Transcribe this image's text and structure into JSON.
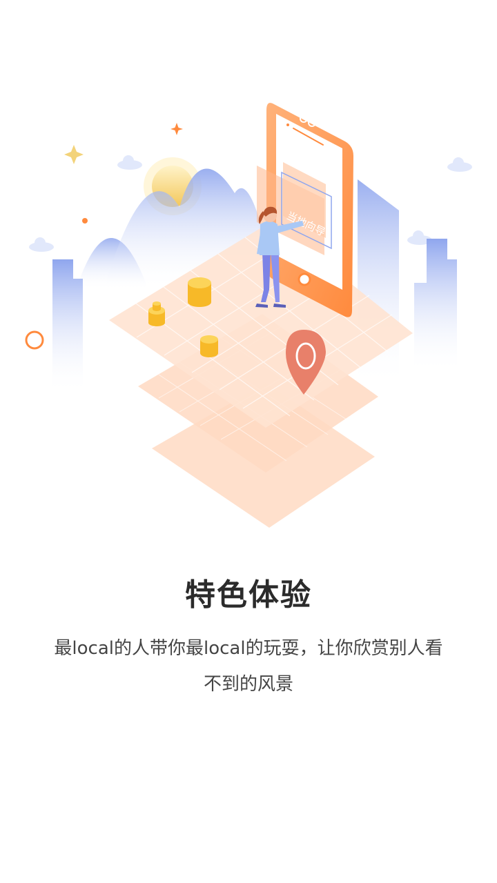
{
  "onboarding": {
    "title": "特色体验",
    "description": "最local的人带你最local的玩耍，让你欣赏别人看不到的风景"
  },
  "illustration": {
    "phone_screen_label": "当地向导",
    "icons": [
      "mountain-icon",
      "sun-icon",
      "cloud-icon",
      "building-icon",
      "phone-icon",
      "person-icon",
      "coin-icon",
      "location-pin-icon",
      "sparkle-icon",
      "ring-icon"
    ]
  },
  "colors": {
    "accent_orange": "#ff8a3d",
    "mountain_blue": "#8fa6ee",
    "tile_peach": "#ffd9c2",
    "pin_red": "#e8806a",
    "coin_yellow": "#f9c43a",
    "title_text": "#2b2b2b",
    "body_text": "#444444"
  }
}
